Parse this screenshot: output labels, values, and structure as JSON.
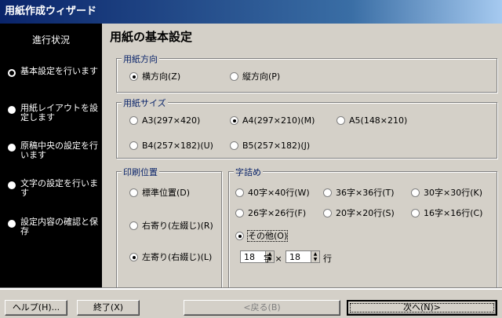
{
  "window": {
    "title": "用紙作成ウィザード"
  },
  "sidebar": {
    "title": "進行状況",
    "steps": [
      {
        "label": "基本設定を行います",
        "selected": true
      },
      {
        "label": "用紙レイアウトを設定します",
        "selected": false
      },
      {
        "label": "原稿中央の設定を行います",
        "selected": false
      },
      {
        "label": "文字の設定を行います",
        "selected": false
      },
      {
        "label": "設定内容の確認と保存",
        "selected": false
      }
    ]
  },
  "main": {
    "title": "用紙の基本設定",
    "orientation": {
      "legend": "用紙方向",
      "options": [
        {
          "label": "横方向(Z)",
          "selected": true
        },
        {
          "label": "縦方向(P)",
          "selected": false
        }
      ]
    },
    "size": {
      "legend": "用紙サイズ",
      "options": [
        {
          "label": "A3(297×420)",
          "selected": false
        },
        {
          "label": "A4(297×210)(M)",
          "selected": true
        },
        {
          "label": "A5(148×210)",
          "selected": false
        },
        {
          "label": "B4(257×182)(U)",
          "selected": false
        },
        {
          "label": "B5(257×182)(J)",
          "selected": false
        }
      ]
    },
    "print_position": {
      "legend": "印刷位置",
      "options": [
        {
          "label": "標準位置(D)",
          "selected": false
        },
        {
          "label": "右寄り(左綴じ)(R)",
          "selected": false
        },
        {
          "label": "左寄り(右綴じ)(L)",
          "selected": true
        }
      ]
    },
    "char_layout": {
      "legend": "字詰め",
      "options": [
        {
          "label": "40字×40行(W)",
          "selected": false
        },
        {
          "label": "36字×36行(T)",
          "selected": false
        },
        {
          "label": "30字×30行(K)",
          "selected": false
        },
        {
          "label": "26字×26行(F)",
          "selected": false
        },
        {
          "label": "20字×20行(S)",
          "selected": false
        },
        {
          "label": "16字×16行(C)",
          "selected": false
        },
        {
          "label": "その他(O)",
          "selected": true
        }
      ],
      "chars_value": "18",
      "chars_unit": "字 ×",
      "lines_value": "18",
      "lines_unit": "行"
    }
  },
  "buttons": {
    "help": "ヘルプ(H)...",
    "finish": "終了(X)",
    "back": "<戻る(B)",
    "next": "次へ(N)>"
  }
}
